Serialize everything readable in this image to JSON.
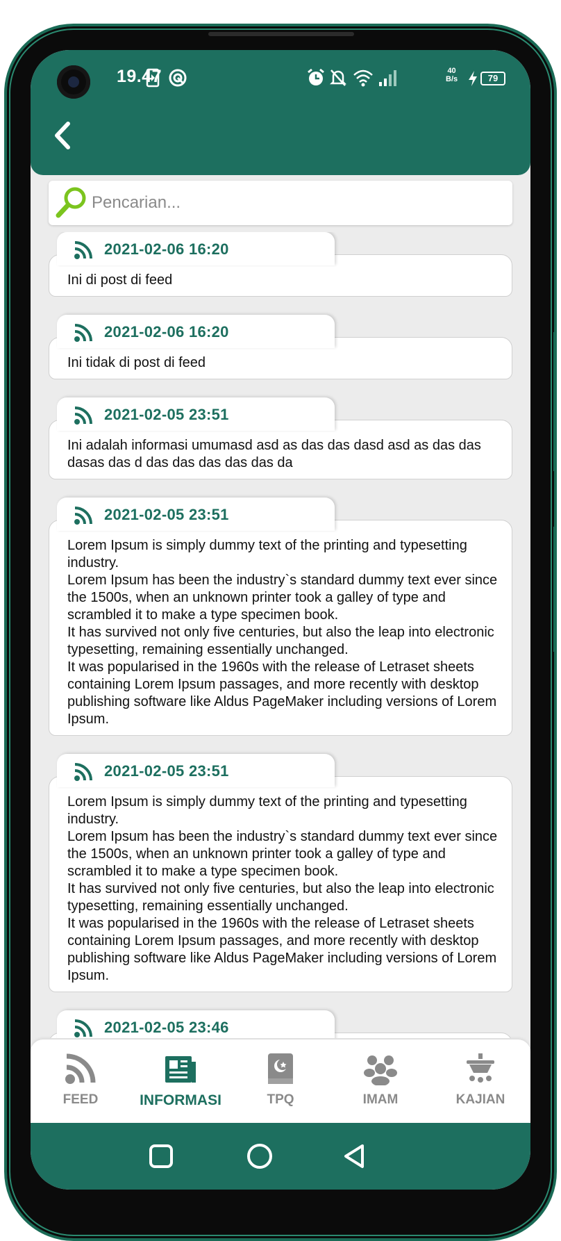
{
  "status_bar": {
    "time": "19.47",
    "net_speed_value": "40",
    "net_speed_unit": "B/s",
    "battery": "79"
  },
  "header": {
    "back_icon": "chevron-left-icon"
  },
  "search": {
    "placeholder": "Pencarian..."
  },
  "feed": {
    "items": [
      {
        "date": "2021-02-06 16:20",
        "text": "Ini di post di feed"
      },
      {
        "date": "2021-02-06 16:20",
        "text": "Ini tidak di post di feed"
      },
      {
        "date": "2021-02-05 23:51",
        "text": "Ini adalah informasi umumasd asd as das das dasd asd as das das dasas das d das das das das das da"
      },
      {
        "date": "2021-02-05 23:51",
        "text": "Lorem Ipsum is simply dummy text of the printing and typesetting industry.\nLorem Ipsum has been the industry`s standard dummy text ever since the 1500s, when an unknown printer took a galley of type and scrambled it to make a type specimen book.\nIt has survived not only five centuries, but also the leap into electronic typesetting, remaining essentially unchanged.\nIt was popularised in the 1960s with the release of Letraset sheets containing Lorem Ipsum passages, and more recently with desktop publishing software like Aldus PageMaker including versions of Lorem Ipsum."
      },
      {
        "date": "2021-02-05 23:51",
        "text": "Lorem Ipsum is simply dummy text of the printing and typesetting industry.\nLorem Ipsum has been the industry`s standard dummy text ever since the 1500s, when an unknown printer took a galley of type and scrambled it to make a type specimen book.\nIt has survived not only five centuries, but also the leap into electronic typesetting, remaining essentially unchanged.\nIt was popularised in the 1960s with the release of Letraset sheets containing Lorem Ipsum passages, and more recently with desktop publishing software like Aldus PageMaker including versions of Lorem Ipsum."
      },
      {
        "date": "2021-02-05 23:46",
        "text": ""
      }
    ]
  },
  "bottom_nav": {
    "items": [
      {
        "label": "FEED",
        "icon": "rss-icon",
        "active": false
      },
      {
        "label": "INFORMASI",
        "icon": "newspaper-icon",
        "active": true
      },
      {
        "label": "TPQ",
        "icon": "quran-book-icon",
        "active": false
      },
      {
        "label": "IMAM",
        "icon": "group-icon",
        "active": false
      },
      {
        "label": "KAJIAN",
        "icon": "kajian-icon",
        "active": false
      }
    ]
  },
  "colors": {
    "primary": "#1d6f5f",
    "background": "#ececec",
    "inactive": "#8a8a8a"
  }
}
